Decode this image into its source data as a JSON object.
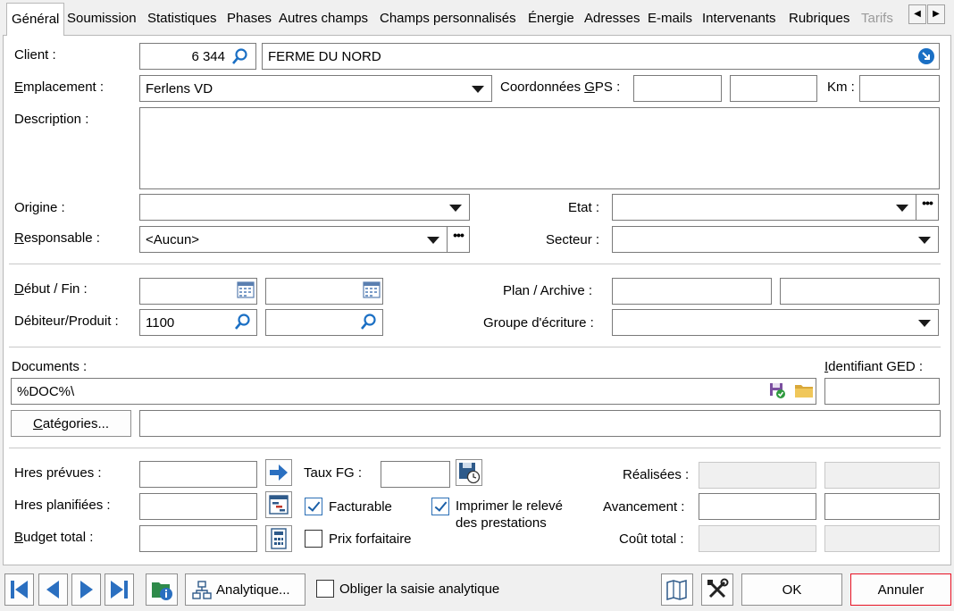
{
  "tabs": [
    "Général",
    "Soumission",
    "Statistiques",
    "Phases",
    "Autres champs",
    "Champs personnalisés",
    "Énergie",
    "Adresses",
    "E-mails",
    "Intervenants",
    "Rubriques",
    "Tarifs"
  ],
  "client": {
    "label": "Client :",
    "number": "6 344",
    "name": "FERME DU NORD"
  },
  "emplacement": {
    "label_u": "E",
    "label_rest": "mplacement :",
    "value": "Ferlens VD"
  },
  "gps": {
    "label_a": "Coordonnées ",
    "label_u": "G",
    "label_b": "PS :",
    "km_label": "Km :"
  },
  "description": {
    "label": "Description :",
    "value": ""
  },
  "origine": {
    "label": "Origine :",
    "value": ""
  },
  "etat": {
    "label": "Etat :",
    "value": ""
  },
  "responsable": {
    "label_u": "R",
    "label_rest": "esponsable :",
    "value": "<Aucun>"
  },
  "secteur": {
    "label": "Secteur :",
    "value": ""
  },
  "debut_fin": {
    "label_u": "D",
    "label_rest": "ébut / Fin :"
  },
  "plan_archive": {
    "label": "Plan / Archive :"
  },
  "debiteur": {
    "label": "Débiteur/Produit :",
    "value": "1100"
  },
  "groupe": {
    "label": "Groupe d'écriture :"
  },
  "documents": {
    "label": "Documents :",
    "value": "%DOC%\\",
    "ged_u": "I",
    "ged_rest": "dentifiant GED :"
  },
  "categories": {
    "btn_u": "C",
    "btn_rest": "atégories..."
  },
  "hours": {
    "prevues": "Hres prévues :",
    "planifiees": "Hres planifiées :",
    "budget_u": "B",
    "budget_rest": "udget total :",
    "taux": "Taux FG :",
    "facturable": "Facturable",
    "forfaitaire": "Prix forfaitaire",
    "imprimer_1": "Imprimer le relevé",
    "imprimer_2": "des prestations",
    "realisees": "Réalisées :",
    "avancement": "Avancement :",
    "cout": "Coût total :"
  },
  "footer": {
    "analytique": "Analytique...",
    "obliger": "Obliger la saisie analytique",
    "ok": "OK",
    "annuler": "Annuler"
  },
  "colors": {
    "accent": "#1a6fc4",
    "cancel_border": "#e81123"
  },
  "icons": [
    "search-icon",
    "go-arrow-icon",
    "calendar-icon",
    "save-doc-icon",
    "folder-icon",
    "arrow-right-icon",
    "gantt-icon",
    "calculator-icon",
    "clock-save-icon",
    "first-icon",
    "prev-icon",
    "next-icon",
    "last-icon",
    "info-icon",
    "network-icon",
    "map-icon",
    "tools-icon"
  ]
}
